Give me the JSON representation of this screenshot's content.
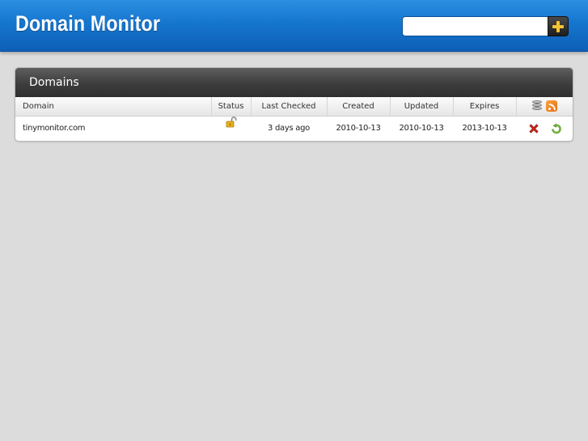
{
  "header": {
    "title": "Domain Monitor",
    "search_placeholder": "",
    "add_button_icon": "plus-icon"
  },
  "panel": {
    "title": "Domains",
    "columns": [
      "Domain",
      "Status",
      "Last Checked",
      "Created",
      "Updated",
      "Expires"
    ],
    "action_icons": [
      "database-icon",
      "rss-icon"
    ],
    "rows": [
      {
        "domain": "tinymonitor.com",
        "status_icon": "unlocked-lock-icon",
        "last_checked": "3 days ago",
        "created": "2010-10-13",
        "updated": "2010-10-13",
        "expires": "2013-10-13",
        "row_action_icons": [
          "delete-icon",
          "refresh-icon"
        ]
      }
    ]
  },
  "colors": {
    "header_blue": "#1676cf",
    "panel_header_dark": "#3d3d3d",
    "page_background": "#dcdcdc",
    "accent_yellow": "#f3c531"
  }
}
